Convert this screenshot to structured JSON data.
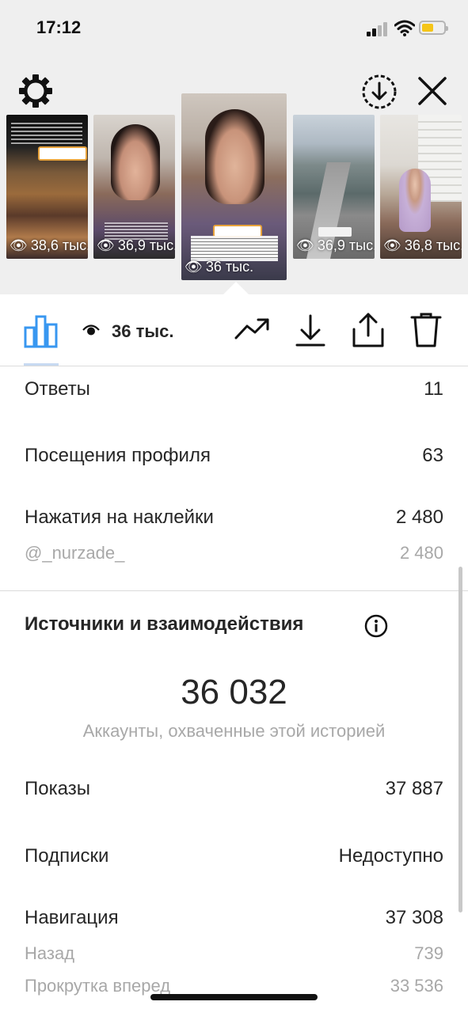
{
  "status_bar": {
    "time": "17:12"
  },
  "stories": [
    {
      "views": "38,6 тыс."
    },
    {
      "views": "36,9 тыс."
    },
    {
      "views": "36 тыс."
    },
    {
      "views": "36,9 тыс."
    },
    {
      "views": "36,8 тыс."
    }
  ],
  "toolbar": {
    "view_count": "36 тыс."
  },
  "metrics": {
    "replies": {
      "label": "Ответы",
      "value": "11"
    },
    "profile_visits": {
      "label": "Посещения профиля",
      "value": "63"
    },
    "sticker_taps": {
      "label": "Нажатия на наклейки",
      "value": "2 480"
    },
    "sticker_mention": {
      "label": "@_nurzade_",
      "value": "2 480"
    }
  },
  "discovery": {
    "title": "Источники и взаимодействия",
    "reach_value": "36 032",
    "reach_caption": "Аккаунты, охваченные этой историей",
    "impressions": {
      "label": "Показы",
      "value": "37 887"
    },
    "follows": {
      "label": "Подписки",
      "value": "Недоступно"
    },
    "navigation": {
      "label": "Навигация",
      "value": "37 308"
    },
    "back": {
      "label": "Назад",
      "value": "739"
    },
    "forward": {
      "label": "Прокрутка вперед",
      "value": "33 536"
    }
  },
  "icons": {
    "gear": "gear-icon",
    "download_circle": "download-circle-icon",
    "close": "close-icon",
    "bar_chart": "bar-chart-icon",
    "eye": "eye-icon",
    "trend": "trend-icon",
    "download": "download-icon",
    "share": "share-icon",
    "trash": "trash-icon",
    "info": "info-icon"
  },
  "colors": {
    "accent": "#3897f0",
    "text": "#262626",
    "secondary": "#a8a8a8",
    "battery": "#f5c518"
  }
}
